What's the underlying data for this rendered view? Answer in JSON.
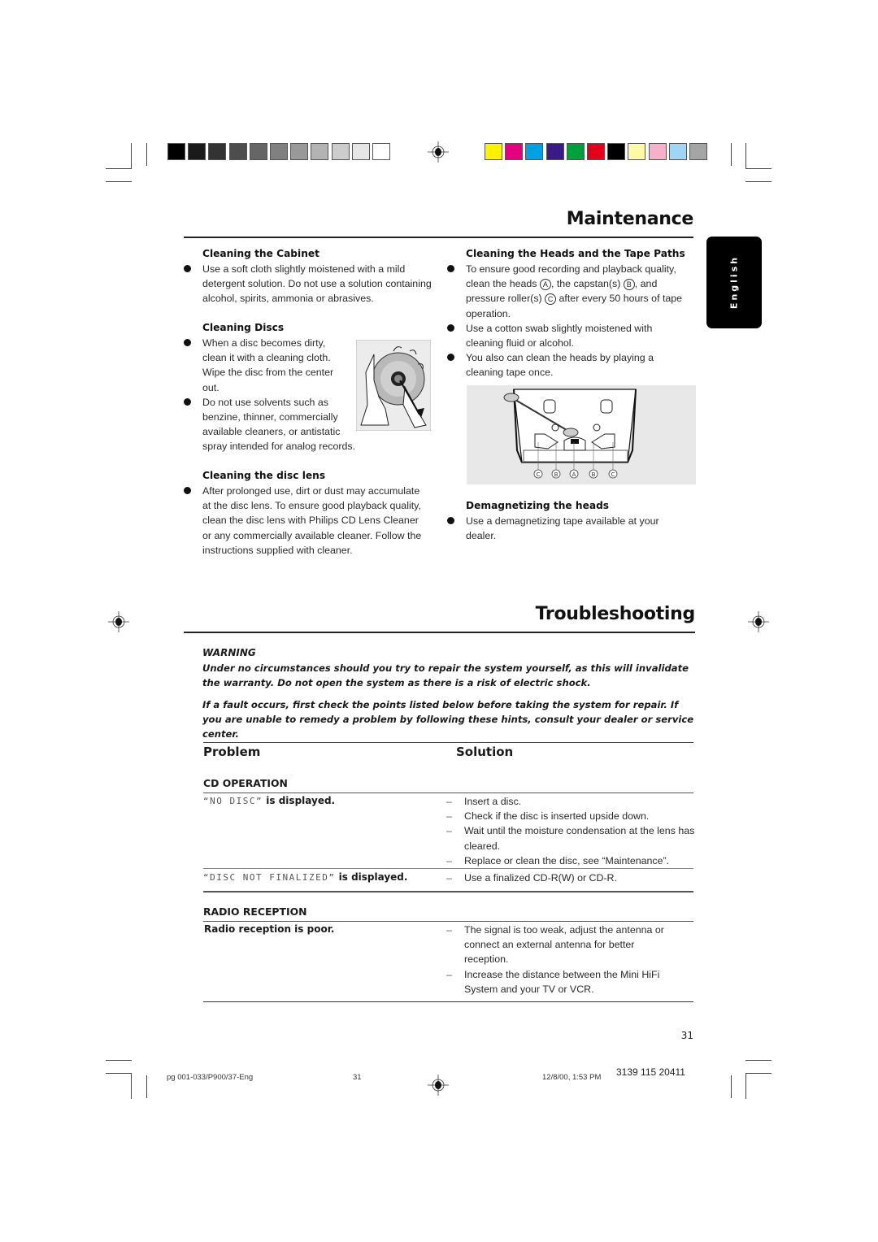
{
  "maintenance": {
    "title": "Maintenance",
    "cabinet": {
      "heading": "Cleaning the Cabinet",
      "bullets": [
        "Use a soft cloth slightly moistened with a mild detergent solution. Do not use a solution containing alcohol, spirits, ammonia or abrasives."
      ]
    },
    "discs": {
      "heading": "Cleaning Discs",
      "bullets": [
        "When a disc becomes dirty, clean it with a cleaning cloth. Wipe the disc from the center out.",
        "Do not use solvents such as benzine, thinner, commercially available cleaners, or antistatic spray intended for analog records."
      ],
      "illustration": "disc-cleaning-illustration"
    },
    "lens": {
      "heading": "Cleaning the disc lens",
      "bullets": [
        "After prolonged use, dirt or dust may accumulate at the disc lens. To ensure good playback quality, clean the disc lens with Philips CD Lens Cleaner or any commercially available cleaner. Follow the instructions supplied with cleaner."
      ]
    },
    "heads": {
      "heading": "Cleaning the Heads and the Tape Paths",
      "bullet1_parts": [
        "To ensure good recording and playback quality, clean the heads ",
        "A",
        ", the capstan(s) ",
        "B",
        ", and pressure roller(s) ",
        "C",
        " after every 50 hours of tape operation."
      ],
      "bullets": [
        "Use a cotton swab slightly moistened with cleaning fluid or alcohol.",
        "You also can clean the heads by playing a cleaning tape once."
      ],
      "diagram_labels": [
        "C",
        "B",
        "A",
        "B",
        "C"
      ]
    },
    "demag": {
      "heading": "Demagnetizing the heads",
      "bullets": [
        "Use a demagnetizing tape available at your dealer."
      ]
    }
  },
  "language_tab": "English",
  "troubleshooting": {
    "title": "Troubleshooting",
    "warning_label": "WARNING",
    "warning_text": "Under no circumstances should you try to repair the system yourself, as this will invalidate the warranty.  Do not open the system as there is a risk of electric shock.",
    "intro_text": "If a fault occurs, first check the points listed below before taking the system for repair. If you are unable to remedy a problem by following these hints, consult your dealer or service center.",
    "col_problem": "Problem",
    "col_solution": "Solution",
    "sections": [
      {
        "name": "CD OPERATION",
        "rows": [
          {
            "lcd": "“NO DISC”",
            "problem_suffix": " is displayed.",
            "solutions": [
              "Insert a disc.",
              "Check if the disc is inserted upside down.",
              "Wait until the moisture condensation at the lens has cleared.",
              "Replace or clean the disc, see “Maintenance”."
            ]
          },
          {
            "lcd": "“DISC NOT FINALIZED”",
            "problem_suffix": " is displayed.",
            "solutions": [
              "Use a finalized CD-R(W) or CD-R."
            ]
          }
        ]
      },
      {
        "name": "RADIO RECEPTION",
        "rows": [
          {
            "problem": "Radio reception is poor.",
            "solutions": [
              "The signal is too weak, adjust the antenna or connect an external antenna for better reception.",
              "Increase the distance between the Mini HiFi System and your TV or VCR."
            ]
          }
        ]
      }
    ]
  },
  "page_number": "31",
  "footer": {
    "file": "pg 001-033/P900/37-Eng",
    "page": "31",
    "datetime": "12/8/00, 1:53 PM",
    "code": "3139 115 20411"
  },
  "color_bar": {
    "grays": [
      "#000000",
      "#1a1a1a",
      "#333333",
      "#4d4d4d",
      "#666666",
      "#808080",
      "#999999",
      "#b3b3b3",
      "#cccccc",
      "#e6e6e6",
      "#ffffff"
    ],
    "colors": [
      "#fff200",
      "#e6007e",
      "#00a0e3",
      "#3c1a85",
      "#00a03c",
      "#e2001a",
      "#000000",
      "#fff9a8",
      "#f7b0c9",
      "#9fd6f5",
      "#a5a5a5"
    ]
  }
}
